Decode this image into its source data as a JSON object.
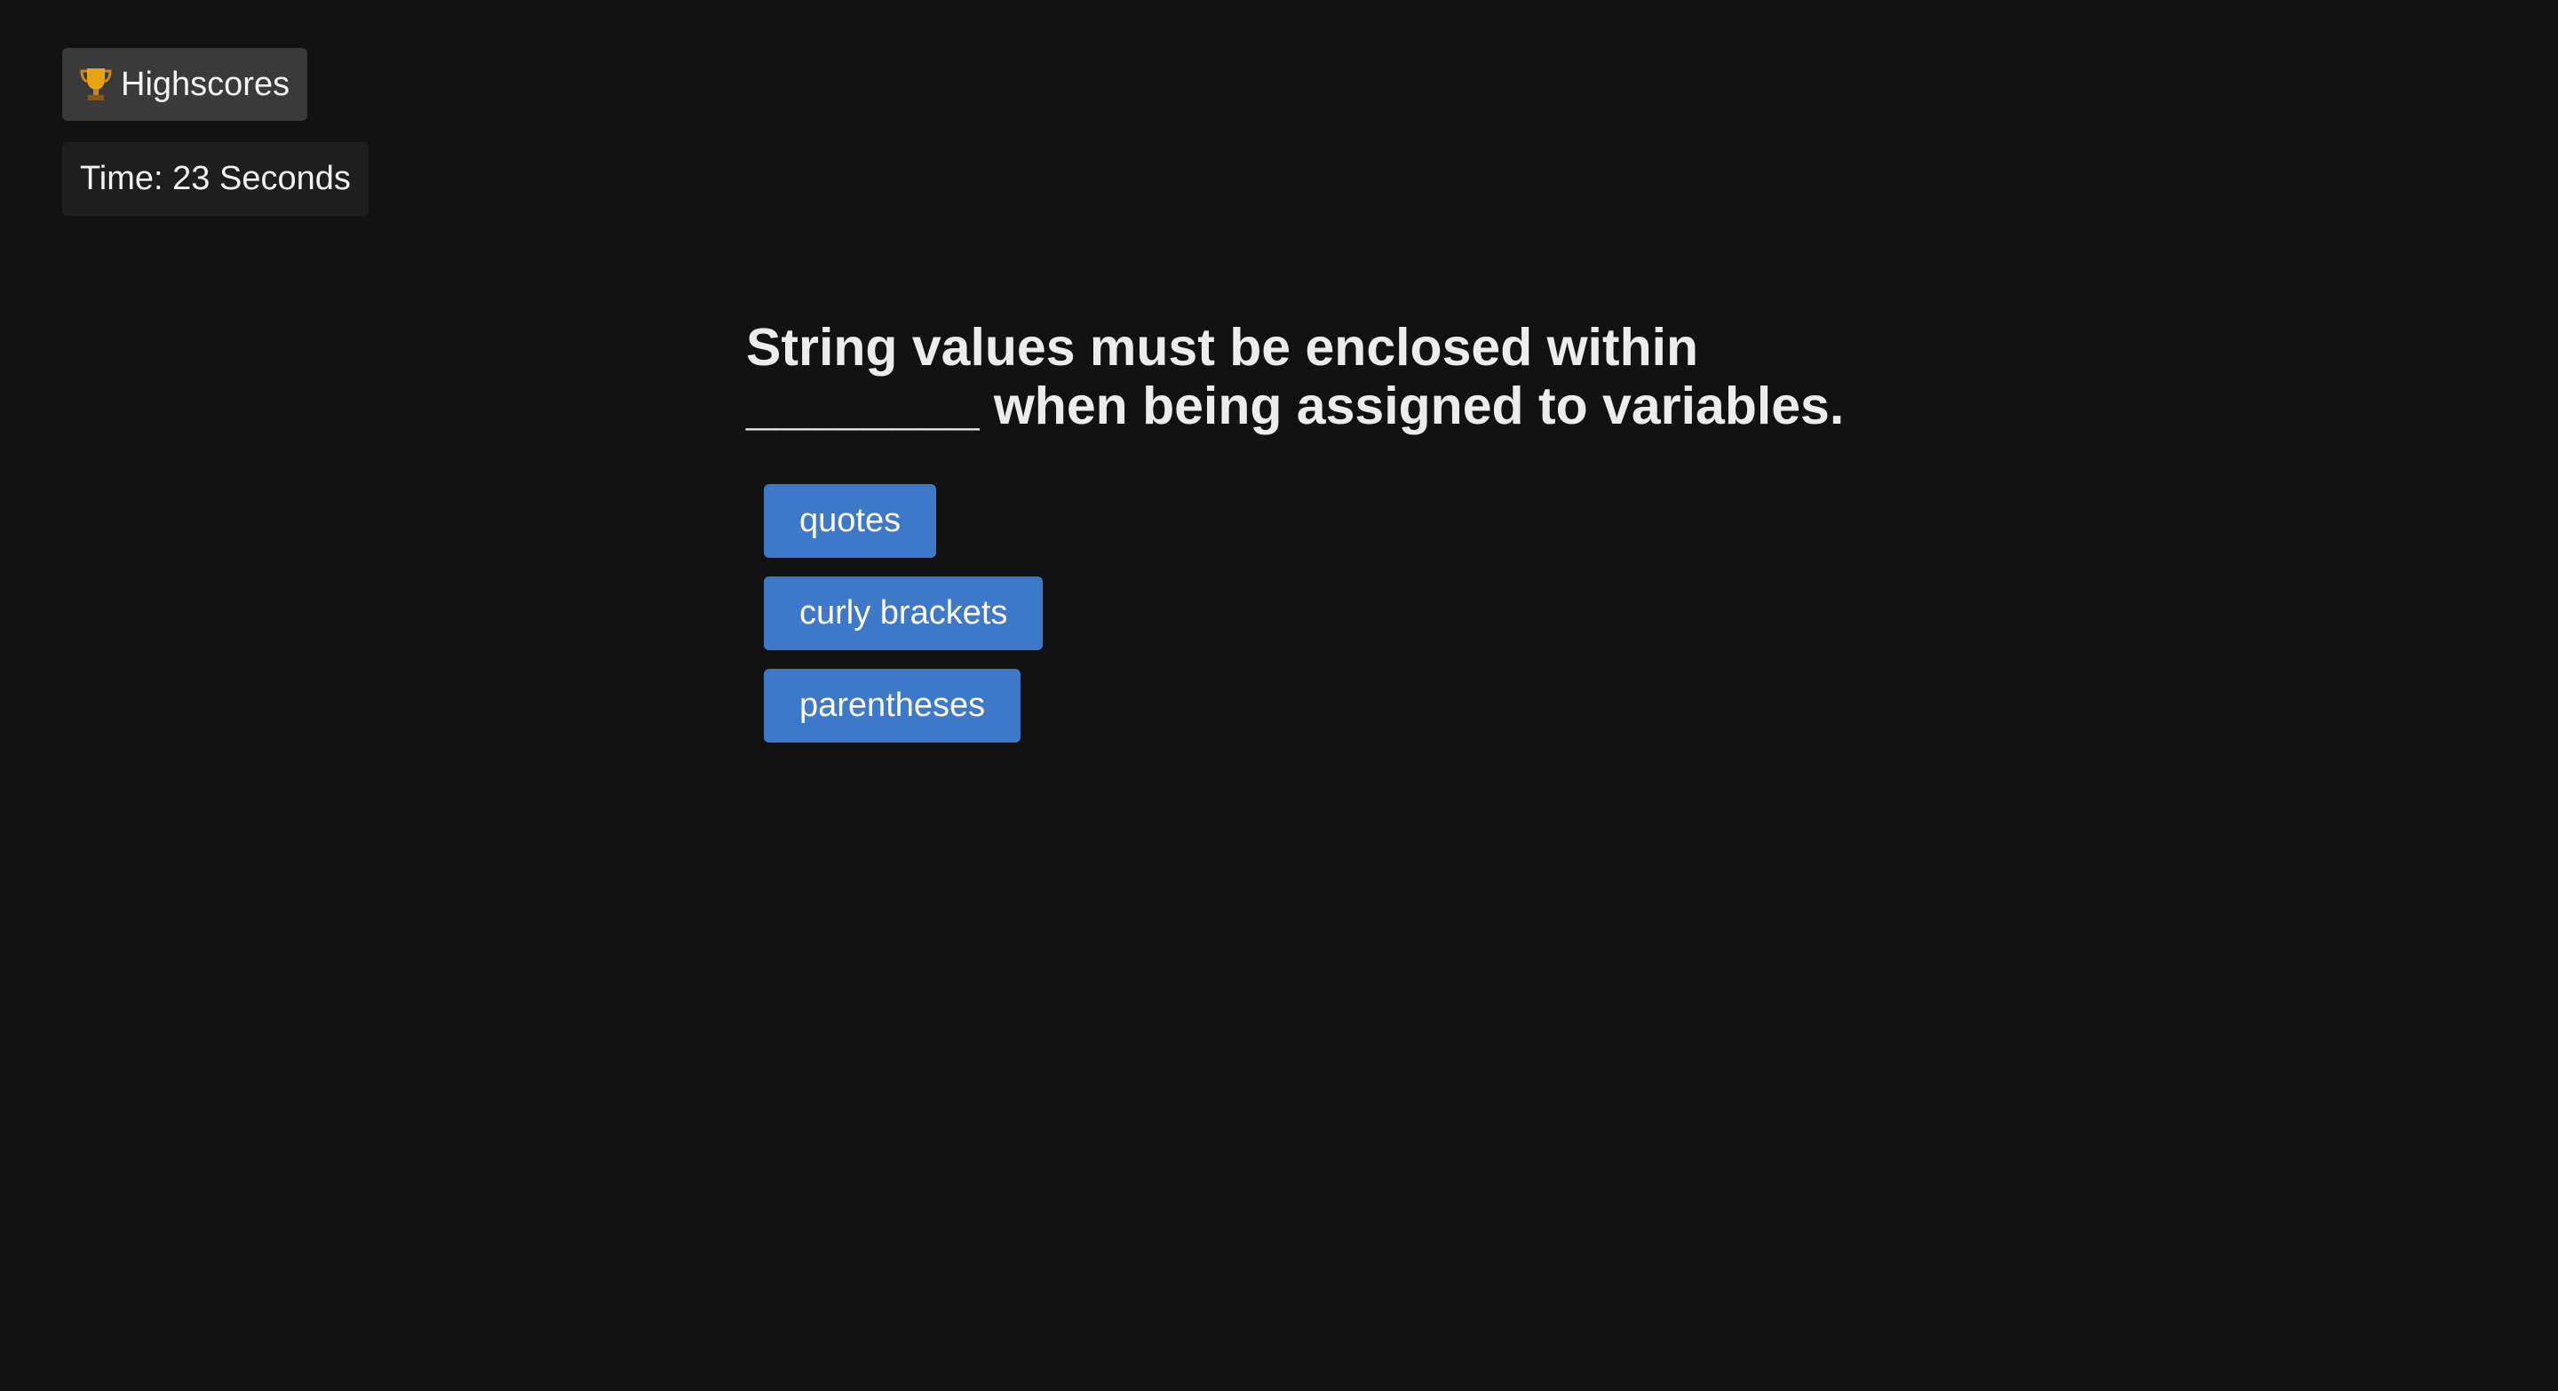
{
  "header": {
    "highscores_label": "Highscores",
    "highscores_icon": "trophy-icon",
    "timer_text": "Time: 23 Seconds"
  },
  "quiz": {
    "question": "String values must be enclosed within ________ when being assigned to variables.",
    "answers": [
      {
        "label": "quotes"
      },
      {
        "label": "curly brackets"
      },
      {
        "label": "parentheses"
      }
    ]
  },
  "colors": {
    "background": "#121212",
    "answer_button": "#3d78c9",
    "highscores_button": "#3a3a3a",
    "timer_background": "#1e1e1e",
    "trophy": "#e8a317"
  }
}
